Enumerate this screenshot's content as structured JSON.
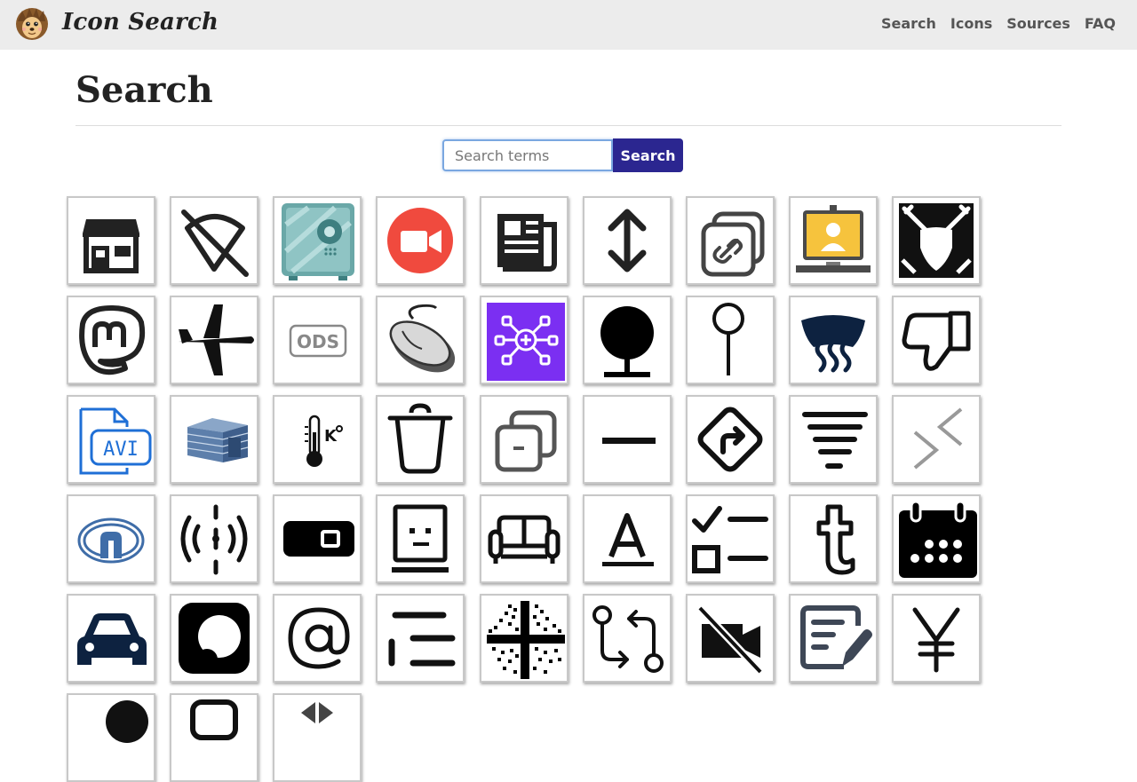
{
  "header": {
    "brand": "Icon Search",
    "logo_icon": "hedgehog-icon",
    "nav": [
      "Search",
      "Icons",
      "Sources",
      "FAQ"
    ]
  },
  "page": {
    "title": "Search"
  },
  "search": {
    "placeholder": "Search terms",
    "value": "",
    "button_label": "Search"
  },
  "icon_results": [
    "store-icon",
    "wifi-off-icon",
    "safe-icon",
    "video-call-icon",
    "newspaper-icon",
    "sort-vertical-icon",
    "copy-link-icon",
    "laptop-user-icon",
    "shield-swords-icon",
    "mastodon-icon",
    "airplane-icon",
    "ods-file-icon",
    "mouse-icon",
    "network-add-icon",
    "pin-icon",
    "map-pin-icon",
    "windshield-heat-icon",
    "thumbs-down-icon",
    "avi-file-icon",
    "shed-icon",
    "thermometer-kelvin-icon",
    "trash-icon",
    "copy-minus-icon",
    "minus-icon",
    "turn-right-sign-icon",
    "filter-icon",
    "collapse-icon",
    "greatwall-logo-icon",
    "broadcast-icon",
    "battery-icon",
    "robot-face-icon",
    "sofa-icon",
    "font-color-icon",
    "checklist-icon",
    "tumblr-icon",
    "calendar-icon",
    "car-icon",
    "app-logo-icon",
    "at-sign-icon",
    "indent-icon",
    "qr-pattern-icon",
    "git-compare-icon",
    "video-off-icon",
    "signature-icon",
    "yen-icon",
    "partial-icon",
    "partial-icon",
    "partial-icon"
  ]
}
